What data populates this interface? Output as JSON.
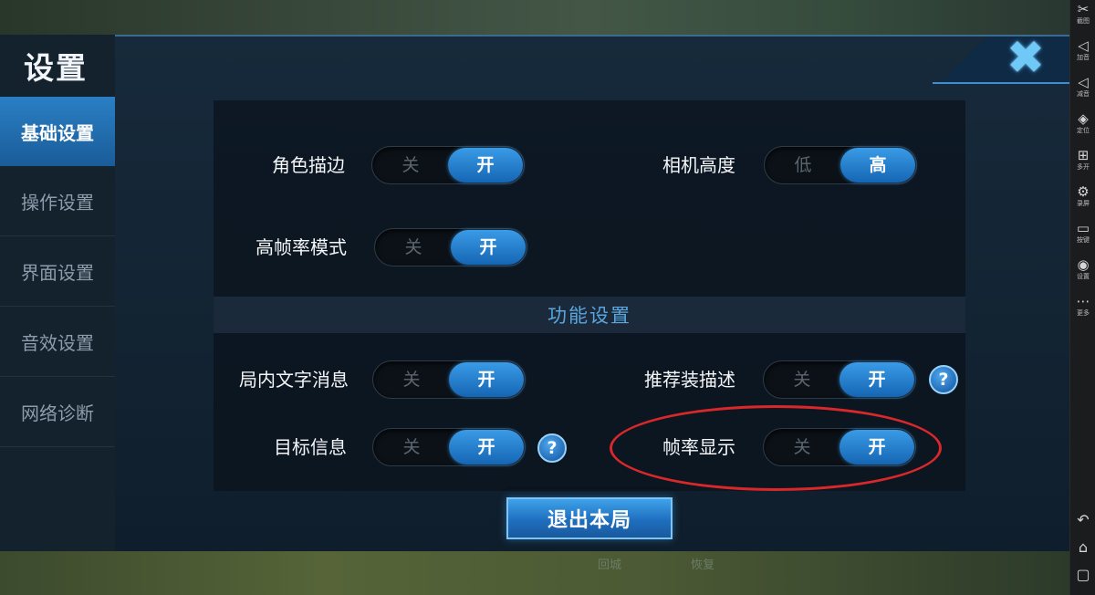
{
  "background": {
    "bottom_ghost_left": "回城",
    "bottom_ghost_right": "恢复"
  },
  "settings": {
    "title": "设置",
    "nav": [
      {
        "label": "基础设置",
        "active": true
      },
      {
        "label": "操作设置",
        "active": false
      },
      {
        "label": "界面设置",
        "active": false
      },
      {
        "label": "音效设置",
        "active": false
      },
      {
        "label": "网络诊断",
        "active": false
      }
    ],
    "rows": {
      "role_outline": {
        "label": "角色描边",
        "off": "关",
        "on": "开"
      },
      "camera_height": {
        "label": "相机高度",
        "off": "低",
        "on": "高"
      },
      "high_fps": {
        "label": "高帧率模式",
        "off": "关",
        "on": "开"
      },
      "text_message": {
        "label": "局内文字消息",
        "off": "关",
        "on": "开"
      },
      "recommend_desc": {
        "label": "推荐装描述",
        "off": "关",
        "on": "开"
      },
      "target_info": {
        "label": "目标信息",
        "off": "关",
        "on": "开"
      },
      "fps_display": {
        "label": "帧率显示",
        "off": "关",
        "on": "开"
      }
    },
    "section_title": "功能设置",
    "help_glyph": "?",
    "close_glyph": "✖",
    "exit_label": "退出本局"
  },
  "toolbar": {
    "items": [
      {
        "icon": "scissors-icon",
        "glyph": "✂",
        "label": "截图"
      },
      {
        "icon": "volume-up-icon",
        "glyph": "◁",
        "label": "加音"
      },
      {
        "icon": "volume-down-icon",
        "glyph": "◁",
        "label": "减音"
      },
      {
        "icon": "location-icon",
        "glyph": "◈",
        "label": "定位"
      },
      {
        "icon": "add-app-icon",
        "glyph": "⊞",
        "label": "多开"
      },
      {
        "icon": "record-icon",
        "glyph": "⚙",
        "label": "录屏"
      },
      {
        "icon": "keyboard-icon",
        "glyph": "▭",
        "label": "按键"
      },
      {
        "icon": "settings-icon",
        "glyph": "◉",
        "label": "设置"
      },
      {
        "icon": "more-icon",
        "glyph": "⋯",
        "label": "更多"
      }
    ],
    "system": [
      {
        "icon": "back-icon",
        "glyph": "↶"
      },
      {
        "icon": "home-icon",
        "glyph": "⌂"
      },
      {
        "icon": "recents-icon",
        "glyph": "▢"
      }
    ]
  },
  "colors": {
    "accent": "#2a7fc4",
    "toggle_on": "#1f72bf",
    "highlight": "#d8282a",
    "section_title": "#5aa6df"
  }
}
